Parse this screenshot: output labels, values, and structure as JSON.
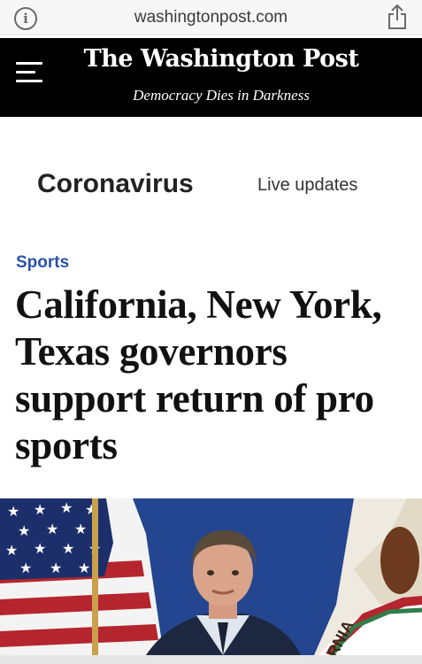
{
  "browser": {
    "domain": "washingtonpost.com",
    "info_icon": "info-icon",
    "share_icon": "share-icon"
  },
  "masthead": {
    "logo": "The Washington Post",
    "tagline": "Democracy Dies in Darkness",
    "menu_icon": "hamburger-menu-icon"
  },
  "topic_bar": {
    "title": "Coronavirus",
    "link": "Live updates"
  },
  "article": {
    "kicker": "Sports",
    "headline": "California, New York, Texas governors support return of pro sports"
  },
  "hero_image": {
    "flag_text": "RNIA",
    "colors": {
      "backdrop": "#274a95",
      "stripe_red": "#b5252d",
      "canton_blue": "#1d2f6b",
      "california_green": "#2f7d4b"
    }
  }
}
